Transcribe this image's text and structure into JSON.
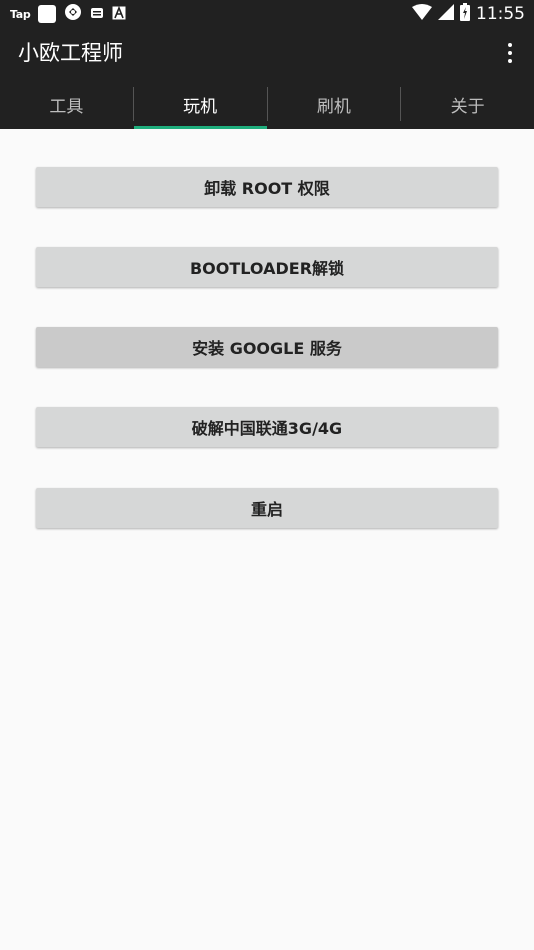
{
  "status_bar": {
    "app_label": "Tap",
    "time": "11:55",
    "icons": [
      "white-square-icon",
      "sync-icon",
      "message-icon",
      "font-icon",
      "wifi-icon",
      "signal-icon",
      "battery-icon"
    ]
  },
  "appbar": {
    "title": "小欧工程师",
    "overflow_icon": "more-vert-icon"
  },
  "tabs": [
    {
      "label": "工具",
      "active": false
    },
    {
      "label": "玩机",
      "active": true
    },
    {
      "label": "刷机",
      "active": false
    },
    {
      "label": "关于",
      "active": false
    }
  ],
  "buttons": [
    {
      "label": "卸载 ROOT 权限"
    },
    {
      "label": "BOOTLOADER解锁"
    },
    {
      "label": "安装 GOOGLE 服务"
    },
    {
      "label": "破解中国联通3G/4G"
    },
    {
      "label": "重启"
    }
  ],
  "colors": {
    "bar_background": "#212121",
    "tab_indicator": "#1fae7d",
    "button_background": "#d6d7d7",
    "page_background": "#fafafa"
  }
}
